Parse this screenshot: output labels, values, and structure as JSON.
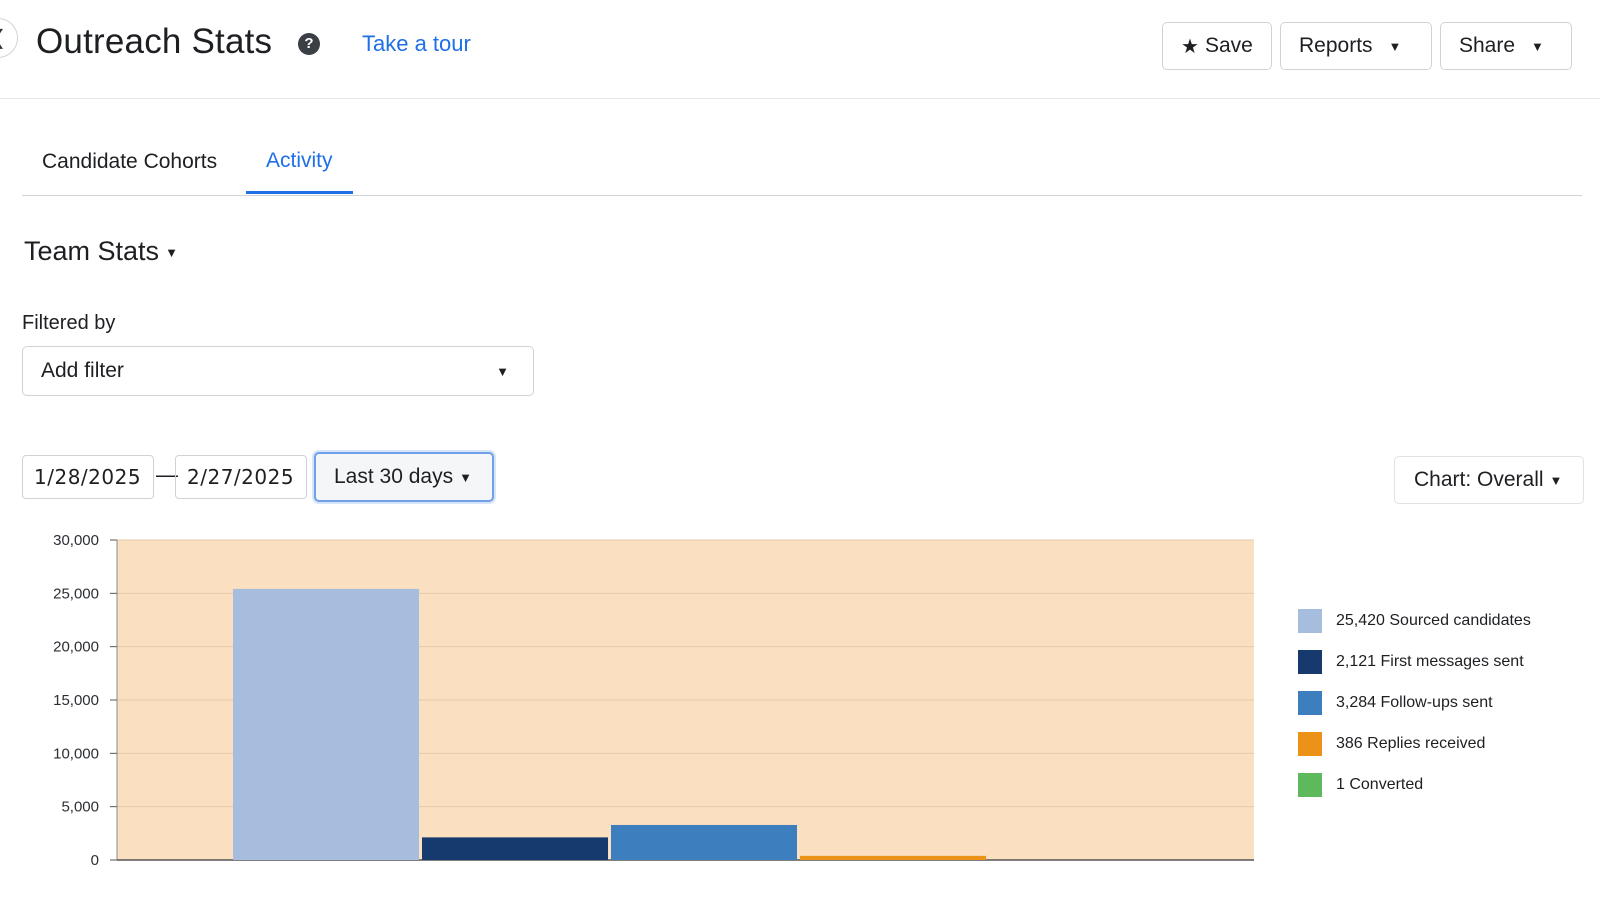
{
  "header": {
    "title": "Outreach Stats",
    "help_icon": "?",
    "tour_link": "Take a tour",
    "save_label": "Save",
    "reports_label": "Reports",
    "share_label": "Share"
  },
  "tabs": [
    {
      "label": "Candidate Cohorts",
      "active": false
    },
    {
      "label": "Activity",
      "active": true
    }
  ],
  "section": {
    "title": "Team Stats"
  },
  "filters": {
    "label": "Filtered by",
    "placeholder": "Add filter"
  },
  "date_range": {
    "start": "1/28/2025",
    "separator": "—",
    "end": "2/27/2025",
    "preset": "Last 30 days"
  },
  "chart_selector": "Chart: Overall",
  "colors": {
    "plot_background": "#fadfc1",
    "sourced": "#a7bddd",
    "first_messages": "#173a6e",
    "follow_ups": "#3d7ebe",
    "replies": "#ec9218",
    "converted": "#5db95c",
    "accent": "#1f6fe5"
  },
  "chart_data": {
    "type": "bar",
    "categories": [
      "Sourced candidates",
      "First messages sent",
      "Follow-ups sent",
      "Replies received",
      "Converted"
    ],
    "values": [
      25420,
      2121,
      3284,
      386,
      1
    ],
    "ylim": [
      0,
      30000
    ],
    "yticks": [
      "0",
      "5,000",
      "10,000",
      "15,000",
      "20,000",
      "25,000",
      "30,000"
    ],
    "grid": true,
    "legend_position": "right",
    "legend": [
      {
        "label": "25,420 Sourced candidates",
        "color": "#a7bddd"
      },
      {
        "label": "2,121 First messages sent",
        "color": "#173a6e"
      },
      {
        "label": "3,284 Follow-ups sent",
        "color": "#3d7ebe"
      },
      {
        "label": "386 Replies received",
        "color": "#ec9218"
      },
      {
        "label": "1 Converted",
        "color": "#5db95c"
      }
    ]
  }
}
